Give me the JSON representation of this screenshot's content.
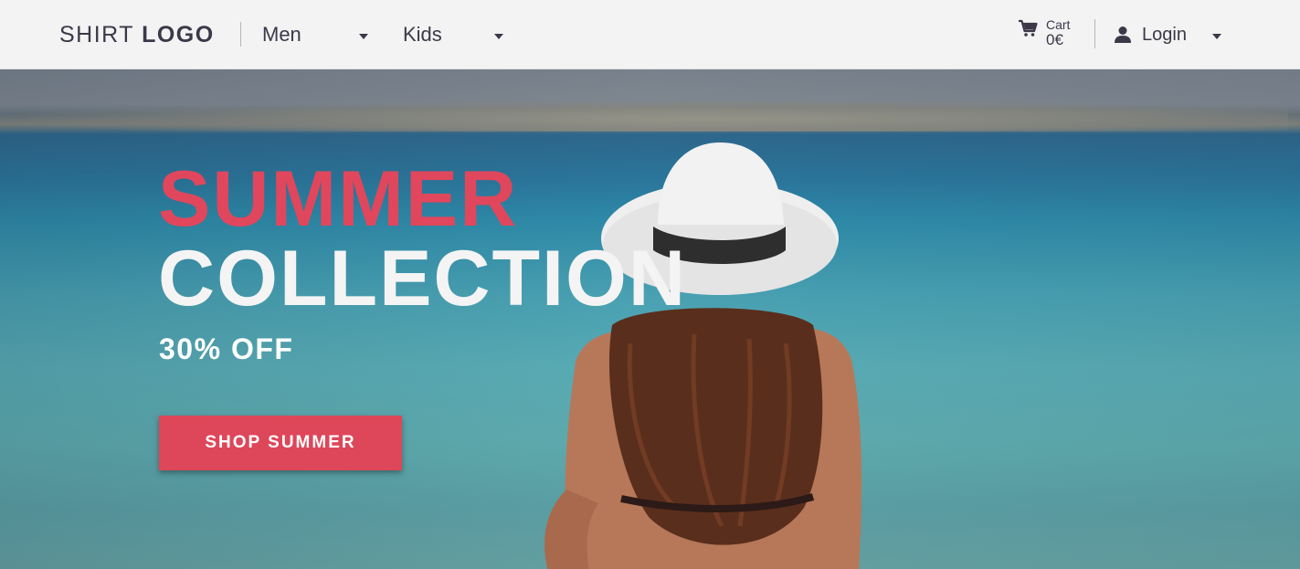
{
  "brand": {
    "logo_light": "SHIRT",
    "logo_bold": "LOGO"
  },
  "nav": {
    "items": [
      {
        "label": "Men"
      },
      {
        "label": "Kids"
      }
    ]
  },
  "cart": {
    "label": "Cart",
    "value": "0€"
  },
  "account": {
    "label": "Login"
  },
  "hero": {
    "title_line1": "SUMMER",
    "title_line2": "COLLECTION",
    "subtitle": "30% OFF",
    "cta_label": "SHOP SUMMER"
  },
  "colors": {
    "accent": "#de4659",
    "text_dark": "#3c3849",
    "navbar_bg": "#f3f3f3",
    "hero_white": "#f4f4f4"
  },
  "icons": [
    "cart-icon",
    "user-icon",
    "chevron-down-icon"
  ]
}
